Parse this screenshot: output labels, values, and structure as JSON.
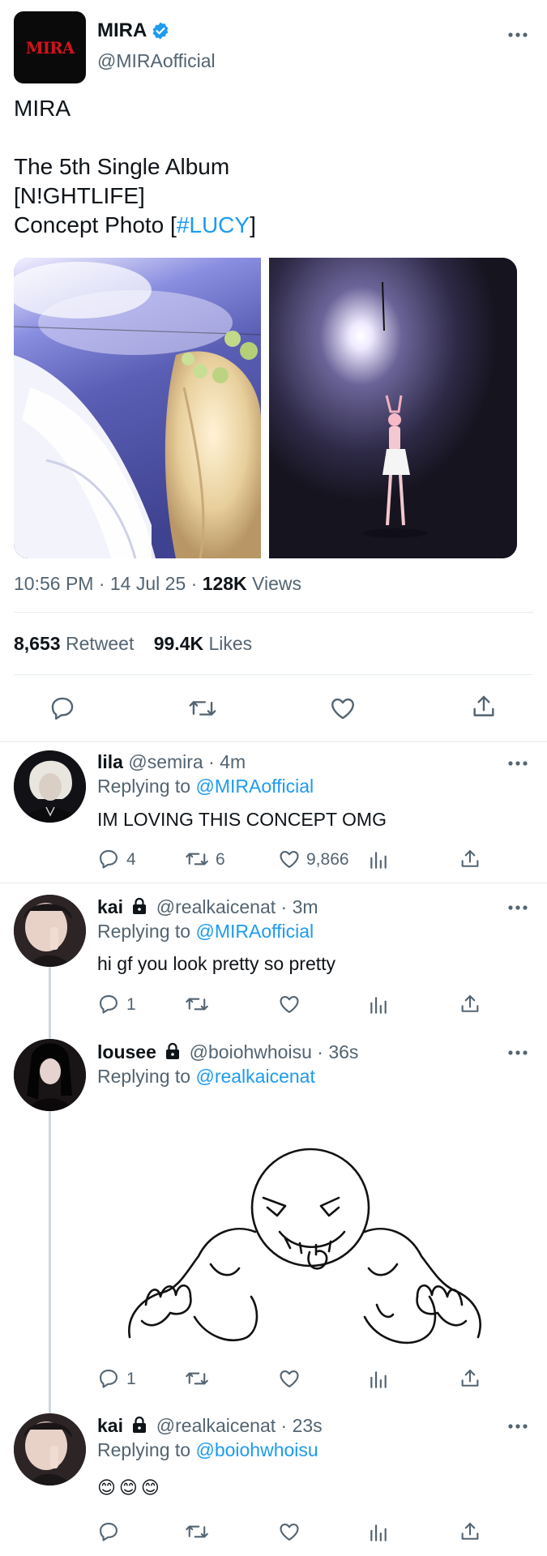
{
  "main_tweet": {
    "logo_text": "MIRA",
    "display_name": "MIRA",
    "handle": "@MIRAofficial",
    "line1": "MIRA",
    "line2": "The 5th Single Album",
    "line3": "[N!GHTLIFE]",
    "line4_prefix": "Concept Photo [",
    "hashtag": "#LUCY",
    "line4_suffix": "]",
    "timestamp": "10:56 PM · 14 Jul 25 · ",
    "views_count": "128K",
    "views_label": " Views",
    "retweets_count": "8,653",
    "retweets_label": "Retweet",
    "likes_count": "99.4K",
    "likes_label": "Likes"
  },
  "replies": [
    {
      "name": "lila",
      "handle": "@semira",
      "time": "· 4m",
      "replying_prefix": "Replying to ",
      "replying_to": "@MIRAofficial",
      "text": "IM LOVING THIS CONCEPT OMG",
      "reply_count": "4",
      "retweet_count": "6",
      "like_count": "9,866"
    },
    {
      "name": "kai",
      "handle": "@realkaicenat",
      "time": "· 3m",
      "replying_prefix": "Replying to ",
      "replying_to": "@MIRAofficial",
      "text": "hi gf you look pretty so pretty",
      "reply_count": "1"
    },
    {
      "name": "lousee",
      "handle": "@boiohwhoisu",
      "time": "· 36s",
      "replying_prefix": "Replying to ",
      "replying_to": "@realkaicenat",
      "reply_count": "1"
    },
    {
      "name": "kai",
      "handle": "@realkaicenat",
      "time": "· 23s",
      "replying_prefix": "Replying to ",
      "replying_to": "@boiohwhoisu",
      "text": "😊😊😊"
    }
  ],
  "colors": {
    "accent": "#1d9bf0",
    "muted": "#536471",
    "divider": "#e6ecf0",
    "logo_red": "#d3121c"
  }
}
